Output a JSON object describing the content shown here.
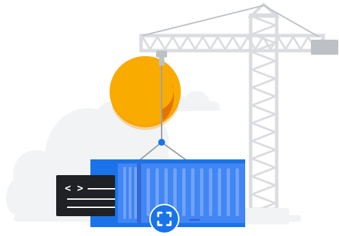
{
  "illustration": {
    "elements": {
      "cloud": {
        "icon": "cloud-icon"
      },
      "sun": {
        "icon": "sun-icon"
      },
      "tower_crane": {
        "icon": "tower-crane-icon"
      },
      "shipping_container": {
        "icon": "shipping-container-icon"
      },
      "code_panel": {
        "icon": "code-brackets-icon",
        "glyph": "< >"
      },
      "container_badge": {
        "icon": "frame-corners-icon"
      }
    },
    "colors": {
      "background": "#FFFFFF",
      "cloud": "#F1F3F4",
      "cloud_outline": "#E8EAED",
      "sun": "#F9AB00",
      "sun_accent": "#F29900",
      "sun_shadow": "#E37400",
      "crane": "#DADCE0",
      "crane_dark": "#BDC1C6",
      "crane_counterweight": "#BDC1C6",
      "container_body": "#4285F4",
      "container_dark": "#1A73E8",
      "container_ribs": "#6FA4F8",
      "container_door": "#3367D6",
      "badge": "#1A73E8",
      "badge_outline": "#FFFFFF",
      "code_panel": "#202124",
      "code_text": "#FFFFFF",
      "cable": "#9AA0A6",
      "hook": "#1A73E8",
      "ground": "#F1F3F4"
    }
  }
}
